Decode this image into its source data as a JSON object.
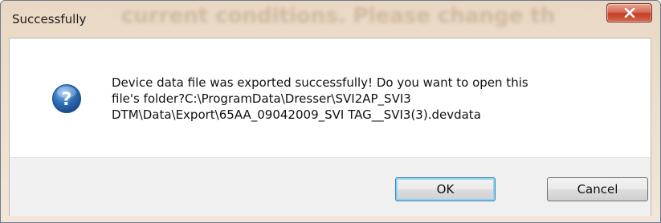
{
  "dialog": {
    "title": "Successfully",
    "background_title_text": "current conditions. Please change th",
    "message": "Device data file was exported successfully! Do you want to open this\nfile's folder?C:\\ProgramData\\Dresser\\SVI2AP_SVI3\nDTM\\Data\\Export\\65AA_09042009_SVI TAG__SVI3(3).devdata",
    "icon": "question-icon",
    "close_icon": "close-icon",
    "buttons": {
      "ok_label": "OK",
      "cancel_label": "Cancel"
    }
  },
  "colors": {
    "title_bar": "#e9d8c4",
    "close_button": "#c23e24",
    "icon_blue": "#2f6fb8",
    "default_button_border": "#3c7fb1"
  }
}
